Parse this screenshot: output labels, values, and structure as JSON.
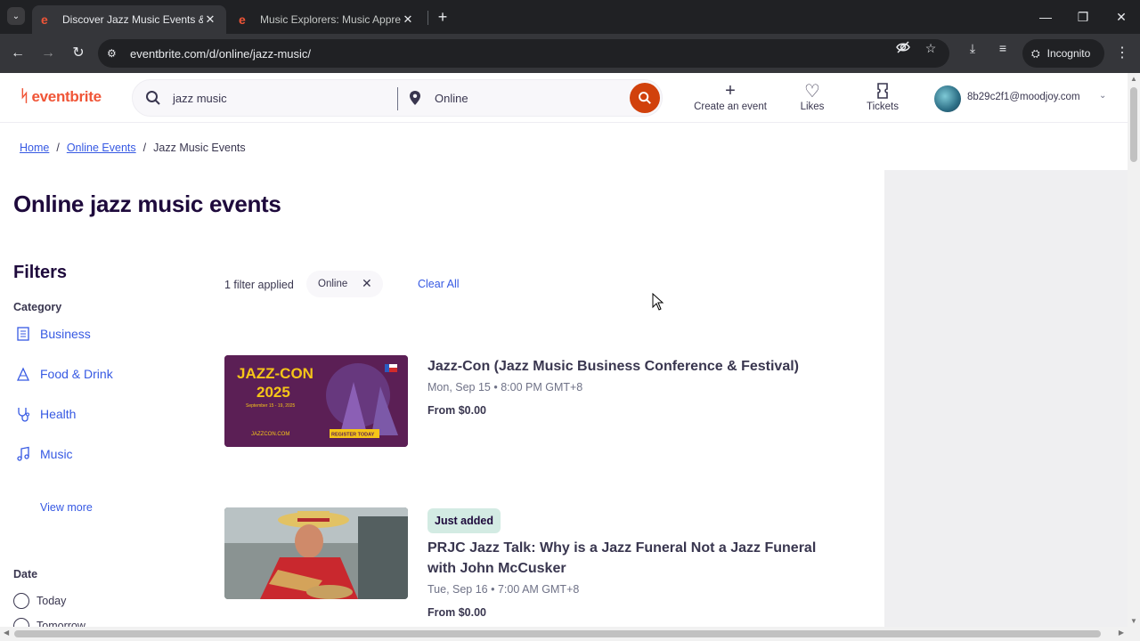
{
  "browser": {
    "tabs": [
      {
        "title": "Discover Jazz Music Events & Activities",
        "active": true
      },
      {
        "title": "Music Explorers: Music Appreciation",
        "active": false
      }
    ],
    "url": "eventbrite.com/d/online/jazz-music/",
    "incognito_label": "Incognito"
  },
  "site": {
    "logo_text": "eventbrite",
    "search_query": "jazz music",
    "location": "Online",
    "actions": {
      "create": "Create an event",
      "likes": "Likes",
      "tickets": "Tickets"
    },
    "account_email": "8b29c2f1@moodjoy.com"
  },
  "breadcrumb": {
    "home": "Home",
    "online_events": "Online Events",
    "current": "Jazz Music Events",
    "separator": "/"
  },
  "page_title": "Online jazz music events",
  "filters": {
    "title": "Filters",
    "category_label": "Category",
    "categories": [
      "Business",
      "Food & Drink",
      "Health",
      "Music"
    ],
    "view_more": "View more",
    "date_label": "Date",
    "date_options": [
      "Today",
      "Tomorrow"
    ]
  },
  "applied": {
    "summary": "1 filter applied",
    "chip": "Online",
    "clear_all": "Clear All"
  },
  "events": [
    {
      "title": "Jazz-Con (Jazz Music Business Conference & Festival)",
      "date": "Mon, Sep 15 • 8:00 PM GMT+8",
      "price": "From $0.00",
      "image_text": {
        "headline": "JAZZ-CON",
        "year": "2025",
        "dates": "September 15 - 19, 2025",
        "site": "JAZZCON.COM",
        "cta": "REGISTER TODAY"
      }
    },
    {
      "badge": "Just added",
      "title_line1": "PRJC Jazz Talk: Why is a Jazz Funeral Not a Jazz Funeral",
      "title_line2": "with John McCusker",
      "date": "Tue, Sep 16 • 7:00 AM GMT+8",
      "price": "From $0.00"
    }
  ],
  "colors": {
    "brand": "#f05537",
    "search_button": "#d1410c",
    "link": "#3659e3",
    "heading": "#1e0a3c",
    "badge_bg": "#d3ebe3"
  }
}
